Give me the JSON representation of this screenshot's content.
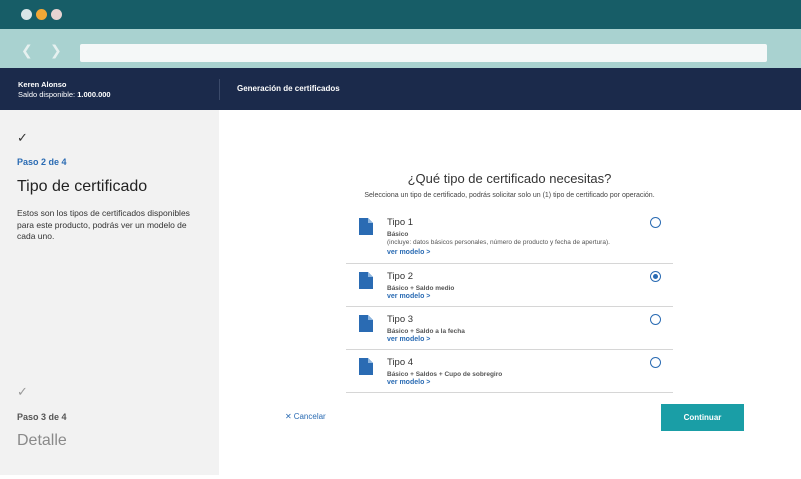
{
  "window": {
    "controls": [
      "close",
      "minimize",
      "maximize"
    ],
    "colors": {
      "titlebar": "#175d67",
      "toolbar": "#a9d2d0",
      "header": "#1b2a4b",
      "accent": "#1a9ea6",
      "link": "#2a6bb3"
    }
  },
  "header": {
    "user_name": "Keren Alonso",
    "balance_label": "Saldo disponible:",
    "balance_value": "1.000.000",
    "title": "Generación de certificados"
  },
  "sidebar": {
    "current_step": {
      "icon": "check-icon",
      "label": "Paso 2 de 4",
      "title": "Tipo de certificado",
      "description": "Estos son los tipos de certificados disponibles para este producto, podrás ver un modelo de cada uno."
    },
    "next_step": {
      "icon": "check-icon",
      "label": "Paso 3 de 4",
      "title": "Detalle"
    }
  },
  "main": {
    "question": "¿Qué tipo de certificado necesitas?",
    "instruction": "Selecciona un tipo de certificado, podrás solicitar solo un (1) tipo de certificado por operación.",
    "options": [
      {
        "title": "Tipo 1",
        "subtitle": "Básico",
        "note": "(incluye: datos básicos personales, número de producto y fecha de apertura).",
        "link": "ver modelo >",
        "selected": false,
        "icon": "document-icon"
      },
      {
        "title": "Tipo 2",
        "subtitle": "Básico + Saldo medio",
        "link": "ver modelo >",
        "selected": true,
        "icon": "document-icon"
      },
      {
        "title": "Tipo 3",
        "subtitle": "Básico + Saldo a la fecha",
        "link": "ver modelo >",
        "selected": false,
        "icon": "document-icon"
      },
      {
        "title": "Tipo 4",
        "subtitle": "Básico + Saldos + Cupo de sobregiro",
        "link": "ver modelo >",
        "selected": false,
        "icon": "document-icon"
      }
    ],
    "cancel_label": "Cancelar",
    "continue_label": "Continuar"
  }
}
